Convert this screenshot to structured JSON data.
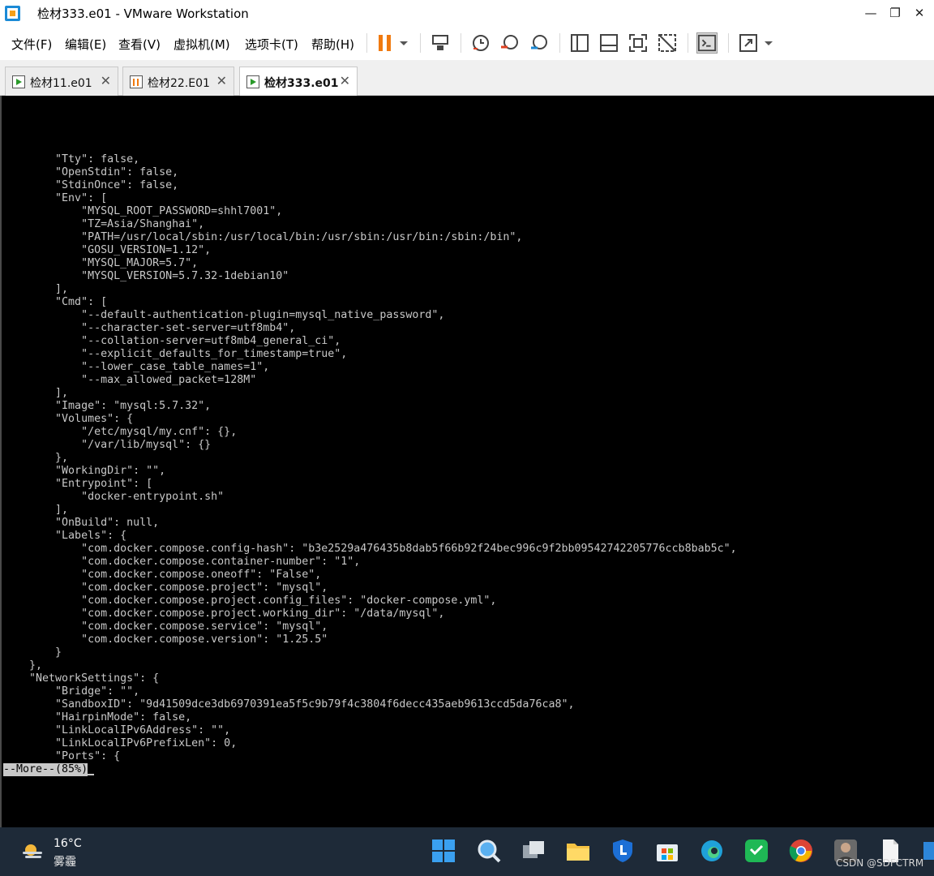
{
  "window": {
    "title": "检材333.e01 - VMware Workstation",
    "minimize_glyph": "—",
    "restore_glyph": "❐",
    "close_glyph": "✕"
  },
  "menu": {
    "items": [
      "文件(F)",
      "编辑(E)",
      "查看(V)",
      "虚拟机(M)",
      "选项卡(T)",
      "帮助(H)"
    ]
  },
  "toolbar": {
    "icons": [
      "pause-icon",
      "send-ctrl-alt-del-icon",
      "snapshot-icon",
      "revert-snapshot-icon",
      "snapshot-manager-icon",
      "show-library-icon",
      "thumbnail-bar-icon",
      "full-screen-icon",
      "unity-icon",
      "console-view-icon",
      "stretch-guest-icon"
    ]
  },
  "tabs": [
    {
      "label": "检材11.e01",
      "state": "running",
      "active": false,
      "close": "✕"
    },
    {
      "label": "检材22.E01",
      "state": "paused",
      "active": false,
      "close": "✕"
    },
    {
      "label": "检材333.e01",
      "state": "running",
      "active": true,
      "close": "✕"
    }
  ],
  "console": {
    "lines": [
      "        \"Tty\": false,",
      "        \"OpenStdin\": false,",
      "        \"StdinOnce\": false,",
      "        \"Env\": [",
      "            \"MYSQL_ROOT_PASSWORD=shhl7001\",",
      "            \"TZ=Asia/Shanghai\",",
      "            \"PATH=/usr/local/sbin:/usr/local/bin:/usr/sbin:/usr/bin:/sbin:/bin\",",
      "            \"GOSU_VERSION=1.12\",",
      "            \"MYSQL_MAJOR=5.7\",",
      "            \"MYSQL_VERSION=5.7.32-1debian10\"",
      "        ],",
      "        \"Cmd\": [",
      "            \"--default-authentication-plugin=mysql_native_password\",",
      "            \"--character-set-server=utf8mb4\",",
      "            \"--collation-server=utf8mb4_general_ci\",",
      "            \"--explicit_defaults_for_timestamp=true\",",
      "            \"--lower_case_table_names=1\",",
      "            \"--max_allowed_packet=128M\"",
      "        ],",
      "        \"Image\": \"mysql:5.7.32\",",
      "        \"Volumes\": {",
      "            \"/etc/mysql/my.cnf\": {},",
      "            \"/var/lib/mysql\": {}",
      "        },",
      "        \"WorkingDir\": \"\",",
      "        \"Entrypoint\": [",
      "            \"docker-entrypoint.sh\"",
      "        ],",
      "        \"OnBuild\": null,",
      "        \"Labels\": {",
      "            \"com.docker.compose.config-hash\": \"b3e2529a476435b8dab5f66b92f24bec996c9f2bb09542742205776ccb8bab5c\",",
      "            \"com.docker.compose.container-number\": \"1\",",
      "            \"com.docker.compose.oneoff\": \"False\",",
      "            \"com.docker.compose.project\": \"mysql\",",
      "            \"com.docker.compose.project.config_files\": \"docker-compose.yml\",",
      "            \"com.docker.compose.project.working_dir\": \"/data/mysql\",",
      "            \"com.docker.compose.service\": \"mysql\",",
      "            \"com.docker.compose.version\": \"1.25.5\"",
      "        }",
      "    },",
      "    \"NetworkSettings\": {",
      "        \"Bridge\": \"\",",
      "        \"SandboxID\": \"9d41509dce3db6970391ea5f5c9b79f4c3804f6decc435aeb9613ccd5da76ca8\",",
      "        \"HairpinMode\": false,",
      "        \"LinkLocalIPv6Address\": \"\",",
      "        \"LinkLocalIPv6PrefixLen\": 0,",
      "        \"Ports\": {"
    ],
    "more_prompt": "--More--(85%)"
  },
  "taskbar": {
    "weather_temp": "16°C",
    "weather_desc": "雾霾",
    "apps": [
      "start-icon",
      "search-icon",
      "task-view-icon",
      "file-explorer-icon",
      "security-app-icon",
      "store-icon",
      "edge-icon",
      "wechat-icon",
      "chrome-icon",
      "user-app-icon",
      "document-icon",
      "system-tray-icon"
    ]
  },
  "watermark": "CSDN @SDFCTRM",
  "colors": {
    "console_bg": "#000000",
    "console_text": "#c8c8c8",
    "taskbar_bg": "#1e2a38",
    "pause_orange": "#f07a10",
    "accent_blue": "#1b8ad6"
  }
}
